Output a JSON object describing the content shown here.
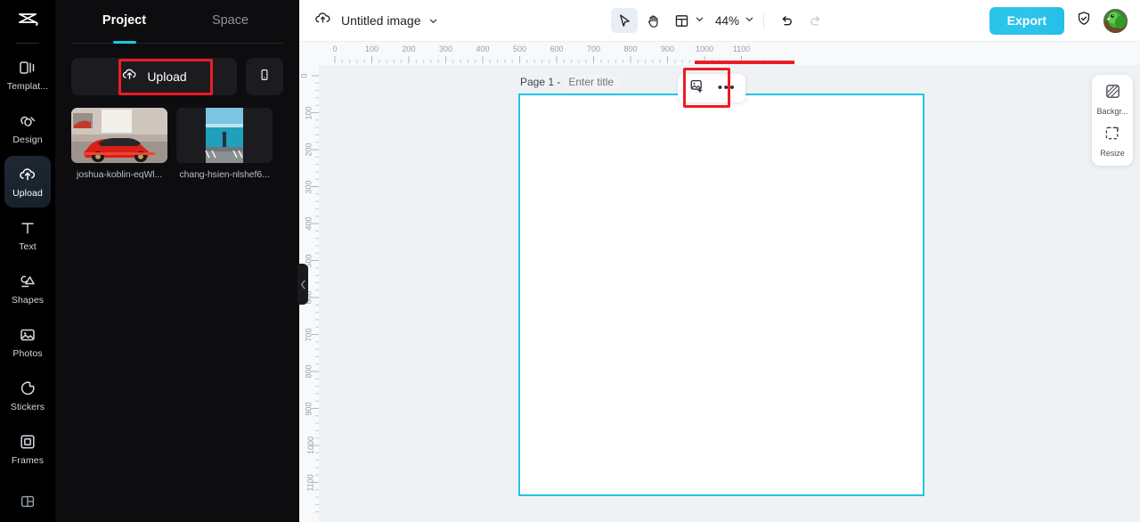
{
  "app": {
    "logo_icon": "capcut-logo-icon",
    "brand_accent": "#1ec7e6",
    "canvas_border_color": "#22c5e6",
    "annotation_color": "#ec1c24"
  },
  "rail": {
    "items": [
      {
        "label": "Templat...",
        "icon": "template-icon",
        "active": false
      },
      {
        "label": "Design",
        "icon": "design-icon",
        "active": false
      },
      {
        "label": "Upload",
        "icon": "cloud-upload-icon",
        "active": true
      },
      {
        "label": "Text",
        "icon": "text-icon",
        "active": false
      },
      {
        "label": "Shapes",
        "icon": "shapes-icon",
        "active": false
      },
      {
        "label": "Photos",
        "icon": "photo-icon",
        "active": false
      },
      {
        "label": "Stickers",
        "icon": "sticker-icon",
        "active": false
      },
      {
        "label": "Frames",
        "icon": "frame-icon",
        "active": false
      }
    ],
    "bottom_icon": "layout-grid-icon"
  },
  "panel": {
    "tabs": [
      {
        "label": "Project",
        "active": true
      },
      {
        "label": "Space",
        "active": false
      }
    ],
    "upload_label": "Upload",
    "upload_icon": "cloud-upload-icon",
    "mobile_icon": "mobile-phone-icon",
    "assets": [
      {
        "name": "joshua-koblin-eqWl...",
        "thumb": "red-sports-car-in-garage"
      },
      {
        "name": "chang-hsien-nlshef6...",
        "thumb": "person-by-turquoise-sea"
      }
    ],
    "collapse_icon": "chevron-left-icon"
  },
  "topbar": {
    "cloud_icon": "cloud-sync-icon",
    "doc_title": "Untitled image",
    "title_chevron_icon": "chevron-down-icon",
    "tools": [
      {
        "name": "select-tool",
        "icon": "cursor-arrow-icon",
        "selected": true
      },
      {
        "name": "hand-tool",
        "icon": "hand-icon",
        "selected": false
      },
      {
        "name": "layout-tool",
        "icon": "layout-panel-icon",
        "selected": false
      }
    ],
    "layout_chevron_icon": "chevron-down-icon",
    "zoom_value": "44%",
    "zoom_chevron_icon": "chevron-down-icon",
    "undo_icon": "undo-arrow-icon",
    "redo_icon": "redo-arrow-icon",
    "export_label": "Export",
    "shield_icon": "shield-check-icon",
    "avatar_icon": "user-avatar"
  },
  "workspace": {
    "ruler_h_ticks": [
      "0",
      "100",
      "200",
      "300",
      "400",
      "500",
      "600",
      "700",
      "800",
      "900",
      "1000",
      "1100"
    ],
    "ruler_v_ticks": [
      "0",
      "100",
      "200",
      "300",
      "400",
      "500",
      "600",
      "700",
      "800",
      "900",
      "1000",
      "1100"
    ],
    "page_label": "Page 1 -",
    "page_title_placeholder": "Enter title",
    "add_image_icon": "add-image-icon",
    "more_options_label": "•••"
  },
  "right_panel": {
    "items": [
      {
        "label": "Backgr...",
        "icon": "background-pattern-icon"
      },
      {
        "label": "Resize",
        "icon": "resize-frame-icon"
      }
    ]
  }
}
